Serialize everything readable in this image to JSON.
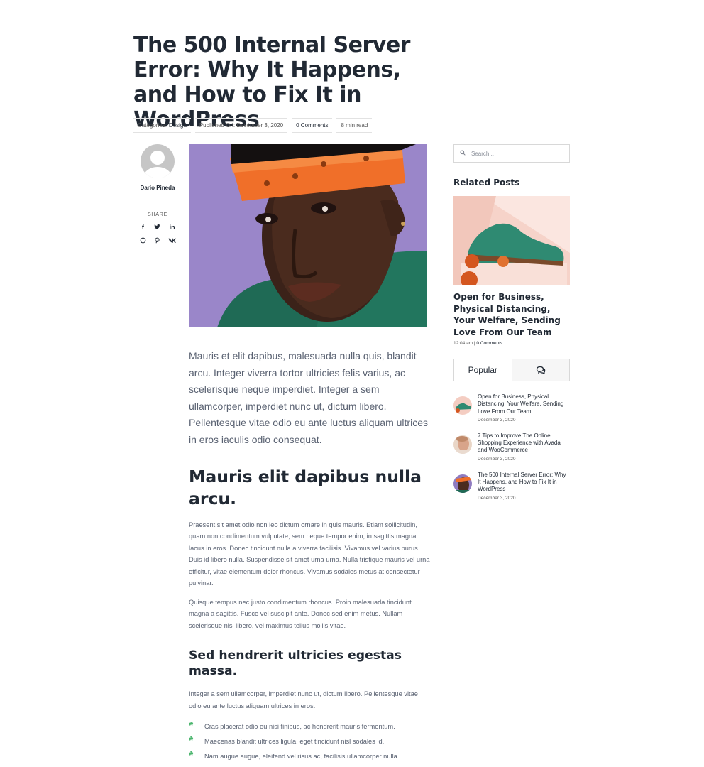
{
  "post": {
    "title": "The 500 Internal Server Error: Why It Happens, and How to Fix It in WordPress",
    "meta": {
      "categories_label": "Categories:",
      "category": "Design",
      "published": "Published On: December 3, 2020",
      "comments": "0 Comments",
      "read_time": "8 min read"
    },
    "author": {
      "name": "Dario Pineda",
      "share_label": "SHARE",
      "share_icons": [
        "facebook-icon",
        "twitter-icon",
        "linkedin-icon",
        "whatsapp-icon",
        "pinterest-icon",
        "vk-icon"
      ]
    },
    "lead": "Mauris et elit dapibus, malesuada nulla quis, blandit arcu. Integer viverra tortor ultricies felis varius, ac scelerisque neque imperdiet. Integer a sem ullamcorper, imperdiet nunc ut, dictum libero. Pellentesque vitae odio eu ante luctus aliquam ultrices in eros iaculis odio consequat.",
    "h2": "Mauris elit dapibus nulla arcu.",
    "p1": "Praesent sit amet odio non leo dictum ornare in quis mauris. Etiam sollicitudin, quam non condimentum vulputate, sem neque tempor enim, in sagittis magna lacus in eros. Donec tincidunt nulla a viverra facilisis. Vivamus vel varius purus. Duis id libero nulla. Suspendisse sit amet urna urna. Nulla tristique mauris vel urna efficitur, vitae elementum dolor rhoncus. Vivamus sodales metus at consectetur pulvinar.",
    "p2": "Quisque tempus nec justo condimentum rhoncus. Proin malesuada tincidunt magna a sagittis. Fusce vel suscipit ante. Donec sed enim metus. Nullam scelerisque nisi libero, vel maximus tellus mollis vitae.",
    "h3": "Sed hendrerit ultricies egestas massa.",
    "p3": "Integer a sem ullamcorper, imperdiet nunc ut, dictum libero. Pellentesque vitae odio eu ante luctus aliquam ultrices in eros:",
    "bullets": [
      "Cras placerat odio eu nisi finibus, ac hendrerit mauris fermentum.",
      "Maecenas blandit ultrices ligula, eget tincidunt nisl sodales id.",
      "Nam augue augue, eleifend vel risus ac, facilisis ullamcorper nulla."
    ]
  },
  "sidebar": {
    "search_placeholder": "Search...",
    "related_title": "Related Posts",
    "related_post": {
      "title": "Open for Business, Physical Distancing, Your Welfare, Sending Love From Our Team",
      "time": "12:04 am",
      "comments": "0 Comments"
    },
    "tabs": {
      "popular": "Popular",
      "comments_icon": "comments-icon"
    },
    "popular": [
      {
        "title": "Open for Business, Physical Distancing, Your Welfare, Sending Love From Our Team",
        "date": "December 3, 2020"
      },
      {
        "title": "7 Tips to Improve The Online Shopping Experience with Avada and WooCommerce",
        "date": "December 3, 2020"
      },
      {
        "title": "The 500 Internal Server Error: Why It Happens, and How to Fix It in WordPress",
        "date": "December 3, 2020"
      }
    ]
  },
  "colors": {
    "heading": "#212934",
    "body": "#5a6272",
    "accent_bullet": "#4ab56d",
    "hero_bg": "#8f7bc0"
  }
}
